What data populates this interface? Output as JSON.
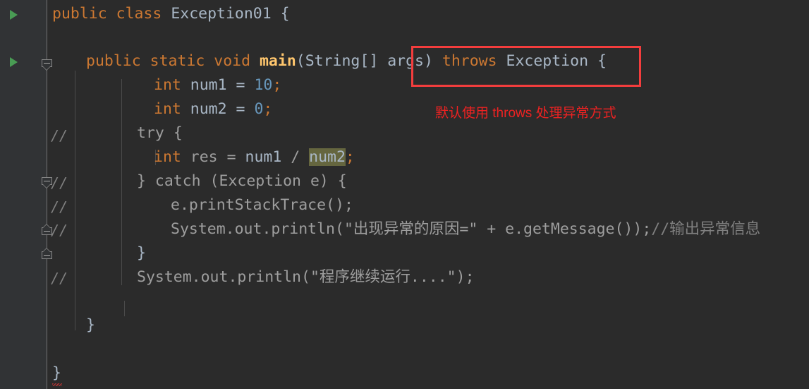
{
  "editor": {
    "theme": "darcula",
    "background": "#2b2b2b",
    "gutter_background": "#313335",
    "accent_red": "#f43d3d",
    "run_arrow_green": "#499c54",
    "highlight_olive": "#65663f"
  },
  "code_lines": [
    {
      "indent": 0,
      "text": "public class Exception01 {",
      "comment_marker": ""
    },
    {
      "indent": 0,
      "text": "",
      "comment_marker": ""
    },
    {
      "indent": 1,
      "text": "public static void main(String[] args) throws Exception {",
      "comment_marker": ""
    },
    {
      "indent": 2,
      "text": "int num1 = 10;",
      "comment_marker": ""
    },
    {
      "indent": 2,
      "text": "int num2 = 0;",
      "comment_marker": ""
    },
    {
      "indent": 2,
      "text": "try {",
      "comment_marker": "//"
    },
    {
      "indent": 3,
      "text": "int res = num1 / num2;",
      "comment_marker": ""
    },
    {
      "indent": 2,
      "text": "} catch (Exception e) {",
      "comment_marker": "//"
    },
    {
      "indent": 3,
      "text": "e.printStackTrace();",
      "comment_marker": "//"
    },
    {
      "indent": 3,
      "text": "System.out.println(\"出现异常的原因=\" + e.getMessage());//输出异常信息",
      "comment_marker": "//"
    },
    {
      "indent": 2,
      "text": "}",
      "comment_marker": ""
    },
    {
      "indent": 2,
      "text": "System.out.println(\"程序继续运行....\");",
      "comment_marker": "//"
    },
    {
      "indent": 0,
      "text": "",
      "comment_marker": ""
    },
    {
      "indent": 1,
      "text": "}",
      "comment_marker": ""
    },
    {
      "indent": 0,
      "text": "",
      "comment_marker": ""
    },
    {
      "indent": 0,
      "text": "}",
      "comment_marker": ""
    }
  ],
  "tokens": {
    "line1": {
      "kw1": "public",
      "kw2": "class",
      "classname": "Exception01",
      "brace": "{"
    },
    "line3": {
      "kw1": "public",
      "kw2": "static",
      "kw3": "void",
      "method": "main",
      "params": "(String[] args)",
      "throws_kw": "throws",
      "throws_type": "Exception",
      "brace": "{"
    },
    "line4": {
      "type": "int",
      "name": "num1",
      "eq": "=",
      "value": "10",
      "semi": ";"
    },
    "line5": {
      "type": "int",
      "name": "num2",
      "eq": "=",
      "value": "0",
      "semi": ";"
    },
    "line6": {
      "text": "try {"
    },
    "line7": {
      "type": "int",
      "name": "res",
      "eq": "=",
      "left": "num1",
      "op": "/",
      "right": "num2",
      "semi": ";"
    },
    "line8": {
      "text": "} catch (Exception e) {"
    },
    "line9": {
      "text": "e.printStackTrace();"
    },
    "line10": {
      "prefix": "System.out.println(",
      "string": "\"出现异常的原因=\"",
      "plus": "+",
      "call": "e.getMessage());",
      "trailing_comment": "//输出异常信息"
    },
    "line11": {
      "text": "}"
    },
    "line12": {
      "prefix": "System.out.println(",
      "string": "\"程序继续运行....\"",
      "suffix": ");"
    },
    "line14": {
      "text": "}"
    },
    "line16": {
      "text": "}"
    }
  },
  "comment_markers": [
    "//",
    "//",
    "//",
    "//",
    "//"
  ],
  "gutter": {
    "run_arrows": 2,
    "run_arrow_name": "run-class-arrow",
    "fold_markers": [
      {
        "type": "expanded-start"
      },
      {
        "type": "expanded-start"
      },
      {
        "type": "region-end"
      },
      {
        "type": "region-end"
      }
    ]
  },
  "annotations": {
    "box_label": "throws-exception-highlight-box",
    "note_text": "默认使用 throws 处理异常方式",
    "note_color": "#ee2222"
  },
  "highlighted_symbol": "num2"
}
